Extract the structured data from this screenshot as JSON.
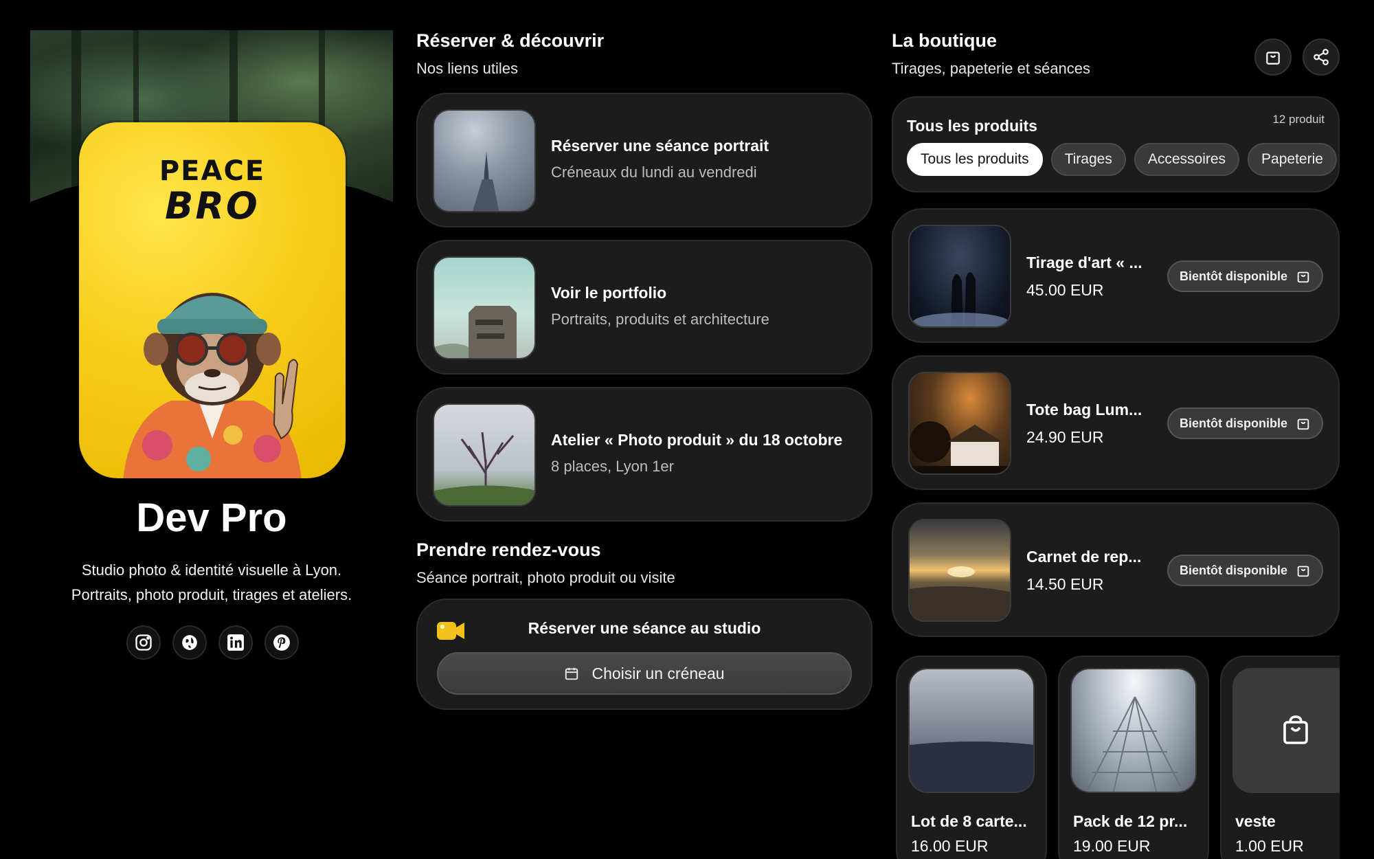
{
  "profile": {
    "name": "Dev Pro",
    "bio_line1": "Studio photo & identité visuelle à Lyon.",
    "bio_line2": "Portraits, photo produit, tirages et ateliers.",
    "avatar_text_line1": "PEACE",
    "avatar_text_line2": "BRO",
    "socials": [
      "instagram-icon",
      "globe-icon",
      "linkedin-icon",
      "pinterest-icon"
    ]
  },
  "links_section": {
    "title": "Réserver & découvrir",
    "subtitle": "Nos liens utiles",
    "items": [
      {
        "title": "Réserver une séance portrait",
        "desc": "Créneaux du lundi au vendredi"
      },
      {
        "title": "Voir le portfolio",
        "desc": "Portraits, produits et architecture"
      },
      {
        "title": "Atelier « Photo produit » du 18 octobre",
        "desc": "8 places, Lyon 1er"
      }
    ]
  },
  "booking_section": {
    "title": "Prendre rendez-vous",
    "subtitle": "Séance portrait, photo produit ou visite",
    "card_title": "Réserver une séance au studio",
    "button_label": "Choisir un créneau"
  },
  "shop": {
    "title": "La boutique",
    "subtitle": "Tirages, papeterie et séances",
    "filter_title": "Tous les produits",
    "count": "12 produit",
    "chips": [
      "Tous les produits",
      "Tirages",
      "Accessoires",
      "Papeterie"
    ],
    "products": [
      {
        "name": "Tirage d'art « ...",
        "price": "45.00 EUR",
        "button": "Bientôt disponible"
      },
      {
        "name": "Tote bag Lum...",
        "price": "24.90 EUR",
        "button": "Bientôt disponible"
      },
      {
        "name": "Carnet de rep...",
        "price": "14.50 EUR",
        "button": "Bientôt disponible"
      }
    ],
    "grid": [
      {
        "name": "Lot de 8 carte...",
        "price": "16.00 EUR"
      },
      {
        "name": "Pack de 12 pr...",
        "price": "19.00 EUR"
      },
      {
        "name": "veste",
        "price": "1.00 EUR"
      }
    ]
  },
  "colors": {
    "accent_yellow": "#f7cd1b",
    "card_bg": "#1c1c1c"
  }
}
